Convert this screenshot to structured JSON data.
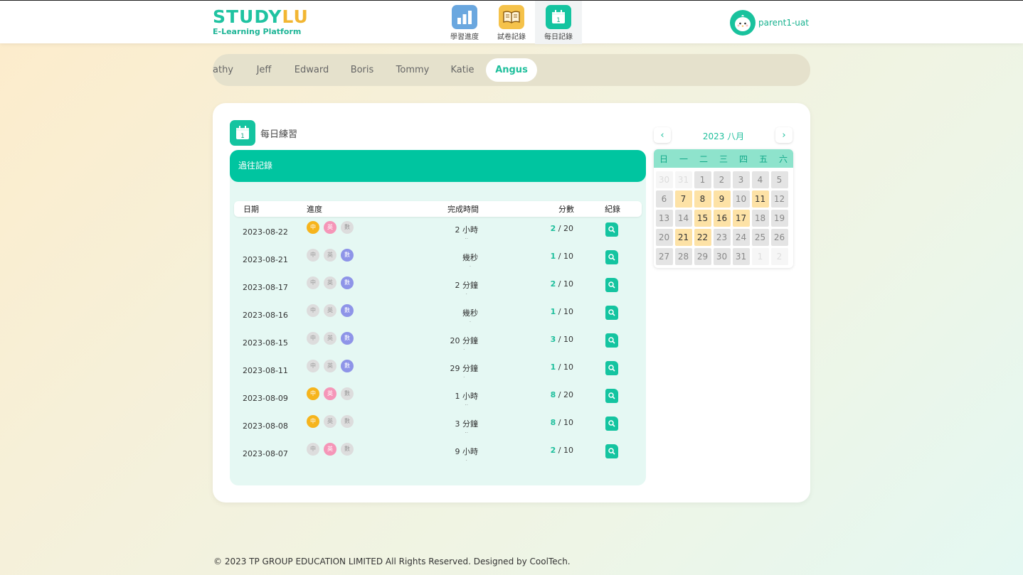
{
  "header": {
    "logo_part1": "STUDY",
    "logo_part2": "LU",
    "logo_sub": "E-Learning Platform",
    "nav": [
      {
        "label": "學習進度",
        "icon": "bar-chart-icon",
        "color": "#6aa7df"
      },
      {
        "label": "試卷記錄",
        "icon": "book-icon",
        "color": "#f5c24a"
      },
      {
        "label": "每日記錄",
        "icon": "calendar-icon",
        "color": "#14c4a0"
      }
    ],
    "username": "parent1-uat"
  },
  "tabs": [
    "athy",
    "Jeff",
    "Edward",
    "Boris",
    "Tommy",
    "Katie",
    "Angus"
  ],
  "active_tab": "Angus",
  "section": {
    "title": "每日練習",
    "icon_day": "1",
    "records_title": "過往記錄"
  },
  "table": {
    "headers": {
      "date": "日期",
      "progress": "進度",
      "time": "完成時間",
      "score": "分數",
      "record": "紀錄"
    },
    "subject_labels": {
      "zh": "中",
      "en": "英",
      "ma": "數"
    },
    "rows": [
      {
        "date": "2023-08-22",
        "zh": true,
        "en": true,
        "ma": false,
        "time": "2 小時",
        "time_sub": "..",
        "score": "2",
        "total": "/ 20"
      },
      {
        "date": "2023-08-21",
        "zh": false,
        "en": false,
        "ma": true,
        "time": "幾秒",
        "time_sub": ".",
        "score": "1",
        "total": "/ 10"
      },
      {
        "date": "2023-08-17",
        "zh": false,
        "en": false,
        "ma": true,
        "time": "2 分鐘",
        "time_sub": ".",
        "score": "2",
        "total": "/ 10"
      },
      {
        "date": "2023-08-16",
        "zh": false,
        "en": false,
        "ma": true,
        "time": "幾秒",
        "time_sub": ".",
        "score": "1",
        "total": "/ 10"
      },
      {
        "date": "2023-08-15",
        "zh": false,
        "en": false,
        "ma": true,
        "time": "20 分鐘",
        "time_sub": ".",
        "score": "3",
        "total": "/ 10"
      },
      {
        "date": "2023-08-11",
        "zh": false,
        "en": false,
        "ma": true,
        "time": "29 分鐘",
        "time_sub": ".",
        "score": "1",
        "total": "/ 10"
      },
      {
        "date": "2023-08-09",
        "zh": true,
        "en": true,
        "ma": false,
        "time": "1 小時",
        "time_sub": "..",
        "score": "8",
        "total": "/ 20"
      },
      {
        "date": "2023-08-08",
        "zh": true,
        "en": false,
        "ma": false,
        "time": "3 分鐘",
        "time_sub": "..",
        "score": "8",
        "total": "/ 10"
      },
      {
        "date": "2023-08-07",
        "zh": false,
        "en": true,
        "ma": false,
        "time": "9 小時",
        "time_sub": ".",
        "score": "2",
        "total": "/ 10"
      }
    ]
  },
  "calendar": {
    "month_label": "2023 八月",
    "prev": "‹",
    "next": "›",
    "weekdays": [
      "日",
      "一",
      "二",
      "三",
      "四",
      "五",
      "六"
    ],
    "days": [
      {
        "d": "30",
        "t": "other"
      },
      {
        "d": "31",
        "t": "other"
      },
      {
        "d": "1",
        "t": "n"
      },
      {
        "d": "2",
        "t": "n"
      },
      {
        "d": "3",
        "t": "n"
      },
      {
        "d": "4",
        "t": "n"
      },
      {
        "d": "5",
        "t": "n"
      },
      {
        "d": "6",
        "t": "n"
      },
      {
        "d": "7",
        "t": "mark"
      },
      {
        "d": "8",
        "t": "mark"
      },
      {
        "d": "9",
        "t": "mark"
      },
      {
        "d": "10",
        "t": "n"
      },
      {
        "d": "11",
        "t": "mark"
      },
      {
        "d": "12",
        "t": "n"
      },
      {
        "d": "13",
        "t": "n"
      },
      {
        "d": "14",
        "t": "n"
      },
      {
        "d": "15",
        "t": "mark"
      },
      {
        "d": "16",
        "t": "mark"
      },
      {
        "d": "17",
        "t": "mark"
      },
      {
        "d": "18",
        "t": "n"
      },
      {
        "d": "19",
        "t": "n"
      },
      {
        "d": "20",
        "t": "n"
      },
      {
        "d": "21",
        "t": "mark"
      },
      {
        "d": "22",
        "t": "mark"
      },
      {
        "d": "23",
        "t": "n"
      },
      {
        "d": "24",
        "t": "n"
      },
      {
        "d": "25",
        "t": "n"
      },
      {
        "d": "26",
        "t": "n"
      },
      {
        "d": "27",
        "t": "n"
      },
      {
        "d": "28",
        "t": "n"
      },
      {
        "d": "29",
        "t": "n"
      },
      {
        "d": "30",
        "t": "n"
      },
      {
        "d": "31",
        "t": "n"
      },
      {
        "d": "1",
        "t": "other"
      },
      {
        "d": "2",
        "t": "other"
      }
    ]
  },
  "footer": "© 2023 TP GROUP EDUCATION LIMITED All Rights Reserved. Designed by CoolTech.",
  "colors": {
    "accent": "#14c4a0",
    "zh": "#f6b41c",
    "en": "#f596b8",
    "ma": "#8e94e8",
    "marked_day": "#fde2a6"
  }
}
